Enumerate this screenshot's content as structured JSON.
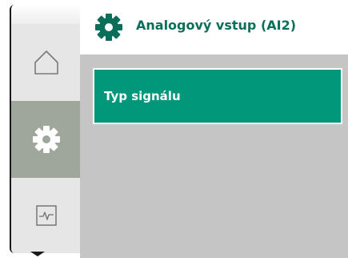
{
  "header": {
    "title": "Analogový vstup (AI2)",
    "icon": "gear-icon"
  },
  "sidebar": {
    "items": [
      {
        "icon": "home-icon",
        "active": false
      },
      {
        "icon": "gear-icon",
        "active": true
      },
      {
        "icon": "diagnostics-icon",
        "active": false
      }
    ],
    "scroll_indicator": "chevron-down-icon"
  },
  "menu": {
    "items": [
      {
        "label": "Typ signálu",
        "selected": true
      }
    ]
  },
  "colors": {
    "accent": "#00977a",
    "title": "#0a6f5a",
    "content_bg": "#c5c5c5",
    "rail_active": "#9ea79a",
    "rail_bg": "#e6e6e6"
  }
}
